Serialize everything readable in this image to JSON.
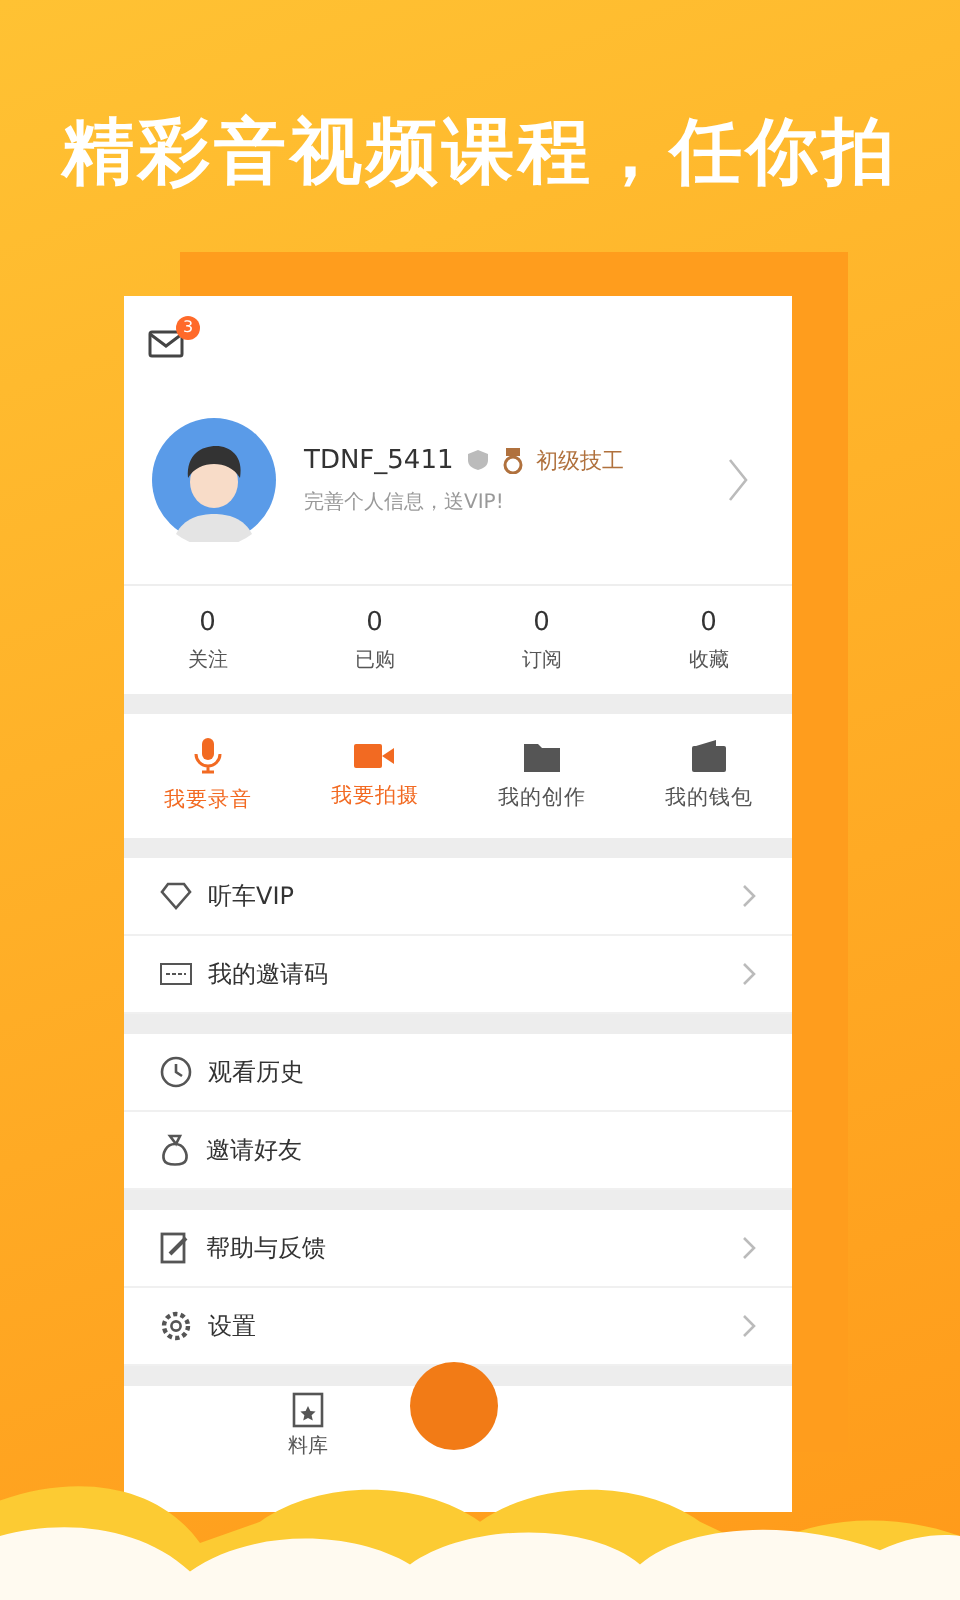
{
  "headline": "精彩音视频课程，任你拍",
  "mail": {
    "badge": "3"
  },
  "profile": {
    "username": "TDNF_5411",
    "level": "初级技工",
    "subtitle": "完善个人信息，送VIP!"
  },
  "stats": [
    {
      "value": "0",
      "label": "关注"
    },
    {
      "value": "0",
      "label": "已购"
    },
    {
      "value": "0",
      "label": "订阅"
    },
    {
      "value": "0",
      "label": "收藏"
    }
  ],
  "actions": [
    {
      "kind": "mic",
      "label": "我要录音",
      "highlighted": true
    },
    {
      "kind": "video",
      "label": "我要拍摄",
      "highlighted": true
    },
    {
      "kind": "folder",
      "label": "我的创作",
      "highlighted": false
    },
    {
      "kind": "wallet",
      "label": "我的钱包",
      "highlighted": false
    }
  ],
  "menu_groups": [
    [
      {
        "kind": "diamond",
        "label": "听车VIP",
        "arrow": true
      },
      {
        "kind": "code",
        "label": "我的邀请码",
        "arrow": true
      }
    ],
    [
      {
        "kind": "clock",
        "label": "观看历史",
        "arrow": false
      },
      {
        "kind": "bag",
        "label": "邀请好友",
        "arrow": false
      }
    ],
    [
      {
        "kind": "edit",
        "label": "帮助与反馈",
        "arrow": true
      },
      {
        "kind": "gear",
        "label": "设置",
        "arrow": true
      }
    ]
  ],
  "tab_bar": {
    "tab_label": "料库"
  }
}
